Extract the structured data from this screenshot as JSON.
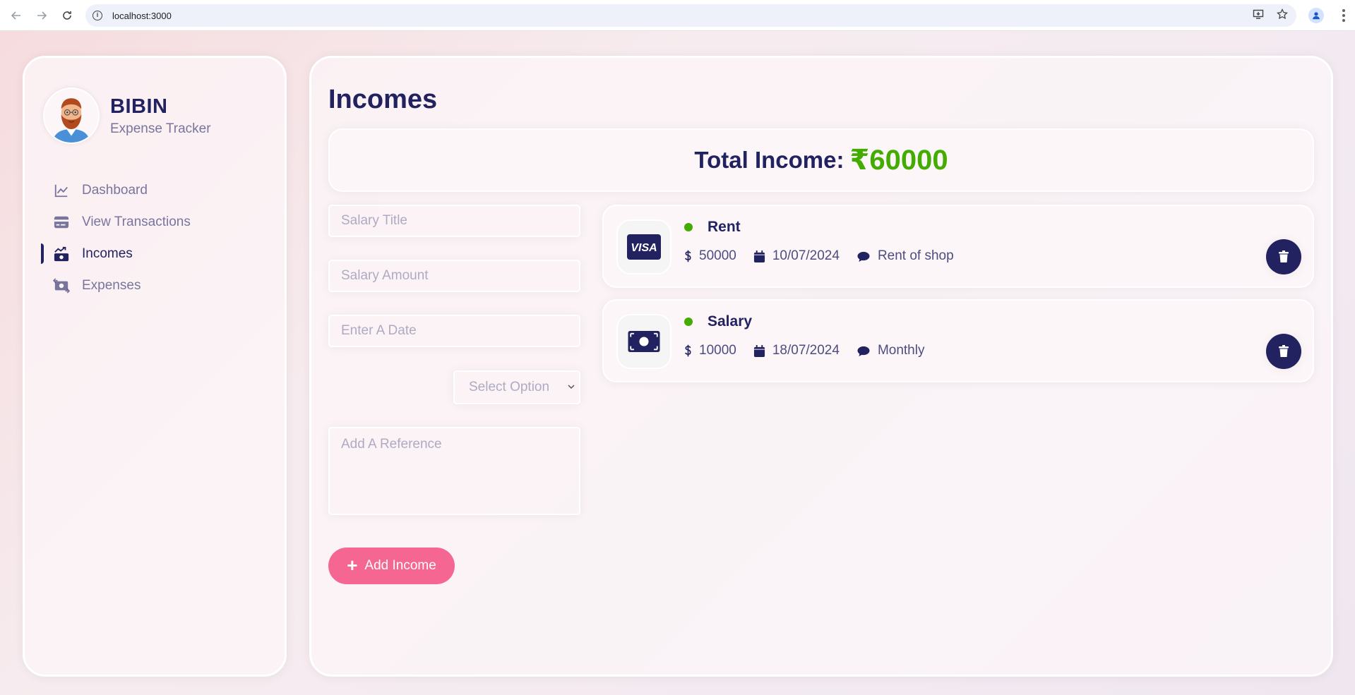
{
  "browser": {
    "url": "localhost:3000"
  },
  "user": {
    "name": "BIBIN",
    "role": "Expense Tracker"
  },
  "menu": {
    "items": [
      {
        "label": "Dashboard",
        "icon": "chart-line-icon",
        "active": false
      },
      {
        "label": "View Transactions",
        "icon": "credit-card-icon",
        "active": false
      },
      {
        "label": "Incomes",
        "icon": "money-bill-trend-up-icon",
        "active": true
      },
      {
        "label": "Expenses",
        "icon": "money-bill-transfer-icon",
        "active": false
      }
    ]
  },
  "main": {
    "title": "Incomes",
    "total_label": "Total Income:",
    "total_amount": "₹60000"
  },
  "form": {
    "title_placeholder": "Salary Title",
    "amount_placeholder": "Salary Amount",
    "date_placeholder": "Enter A Date",
    "select_placeholder": "Select Option",
    "reference_placeholder": "Add A Reference",
    "submit_label": "Add Income"
  },
  "incomes": [
    {
      "title": "Rent",
      "amount": "50000",
      "date": "10/07/2024",
      "description": "Rent of shop",
      "icon": "visa-card-icon"
    },
    {
      "title": "Salary",
      "amount": "10000",
      "date": "18/07/2024",
      "description": "Monthly",
      "icon": "money-bill-icon"
    }
  ],
  "colors": {
    "primary": "#222260",
    "income_green": "#42ad00",
    "button_pink": "#f56692"
  }
}
